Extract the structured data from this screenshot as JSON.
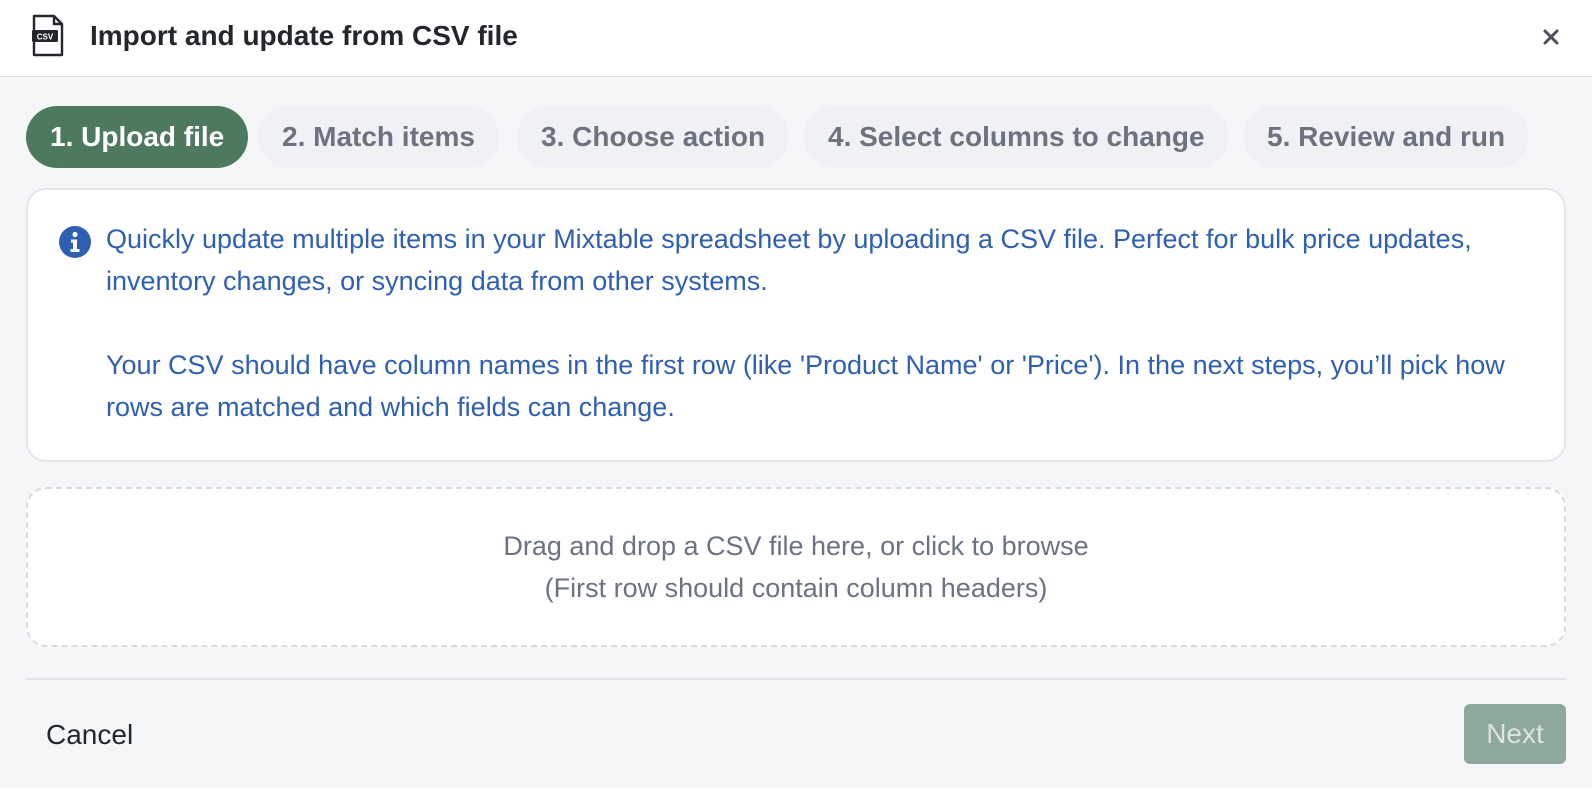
{
  "header": {
    "title": "Import and update from CSV file",
    "file_icon": "csv-file-icon",
    "file_icon_label": "CSV",
    "close_icon": "close-icon"
  },
  "steps": [
    {
      "label": "1. Upload file",
      "active": true
    },
    {
      "label": "2. Match items",
      "active": false
    },
    {
      "label": "3. Choose action",
      "active": false
    },
    {
      "label": "4. Select columns to change",
      "active": false
    },
    {
      "label": "5. Review and run",
      "active": false
    }
  ],
  "info": {
    "icon": "info-icon",
    "paragraph1": "Quickly update multiple items in your Mixtable spreadsheet by uploading a CSV file. Perfect for bulk price updates, inventory changes, or syncing data from other systems.",
    "paragraph2": "Your CSV should have column names in the first row (like 'Product Name' or 'Price'). In the next steps, you’ll pick how rows are matched and which fields can change."
  },
  "dropzone": {
    "line1": "Drag and drop a CSV file here, or click to browse",
    "line2": "(First row should contain column headers)"
  },
  "footer": {
    "cancel_label": "Cancel",
    "next_label": "Next",
    "next_disabled": true
  },
  "colors": {
    "accent": "#4d7a5e",
    "info_text": "#2f5fb3",
    "next_disabled_bg": "#8ea899"
  }
}
